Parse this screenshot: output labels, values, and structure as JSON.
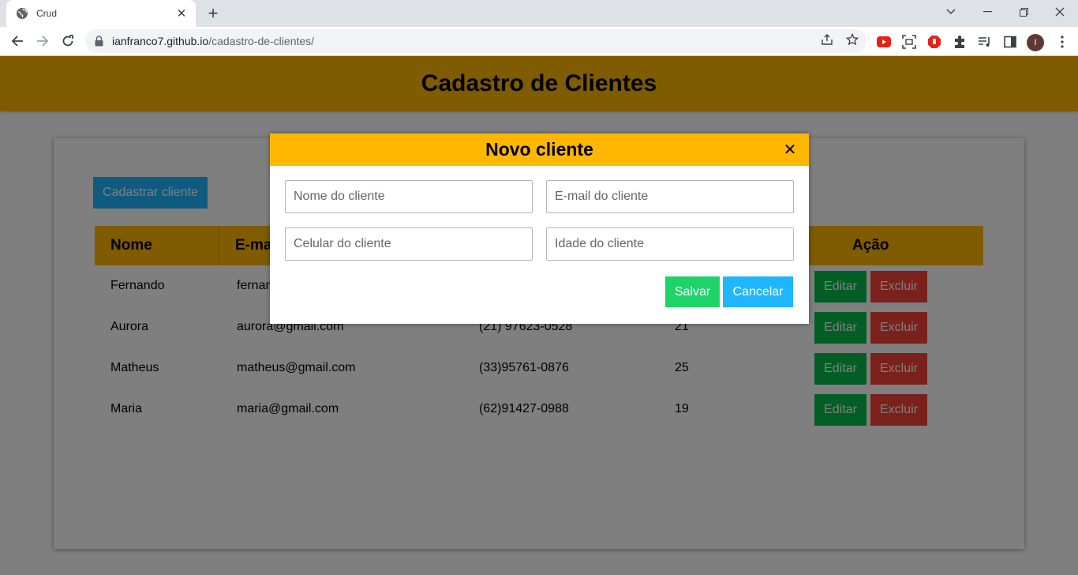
{
  "browser": {
    "tab_title": "Crud",
    "url_domain": "ianfranco7.github.io",
    "url_path": "/cadastro-de-clientes/",
    "profile_initial": "I"
  },
  "header": {
    "title": "Cadastro de Clientes"
  },
  "main": {
    "cadastrar_label": "Cadastrar cliente",
    "columns": {
      "nome": "Nome",
      "email": "E-mail",
      "acao": "Ação"
    },
    "rows": [
      {
        "nome": "Fernando",
        "email": "fernando@gmail.com",
        "celular": "",
        "idade": ""
      },
      {
        "nome": "Aurora",
        "email": "aurora@gmail.com",
        "celular": "(21) 97623-0528",
        "idade": "21"
      },
      {
        "nome": "Matheus",
        "email": "matheus@gmail.com",
        "celular": "(33)95761-0876",
        "idade": "25"
      },
      {
        "nome": "Maria",
        "email": "maria@gmail.com",
        "celular": "(62)91427-0988",
        "idade": "19"
      }
    ],
    "editar_label": "Editar",
    "excluir_label": "Excluir"
  },
  "modal": {
    "title": "Novo cliente",
    "close_glyph": "✕",
    "nome_placeholder": "Nome do cliente",
    "email_placeholder": "E-mail do cliente",
    "celular_placeholder": "Celular do cliente",
    "idade_placeholder": "Idade do cliente",
    "salvar_label": "Salvar",
    "cancelar_label": "Cancelar"
  },
  "colors": {
    "accent_yellow": "#ffb702",
    "button_blue": "#1fb6ff",
    "button_green": "#07bc4c",
    "button_red": "#f44336"
  }
}
